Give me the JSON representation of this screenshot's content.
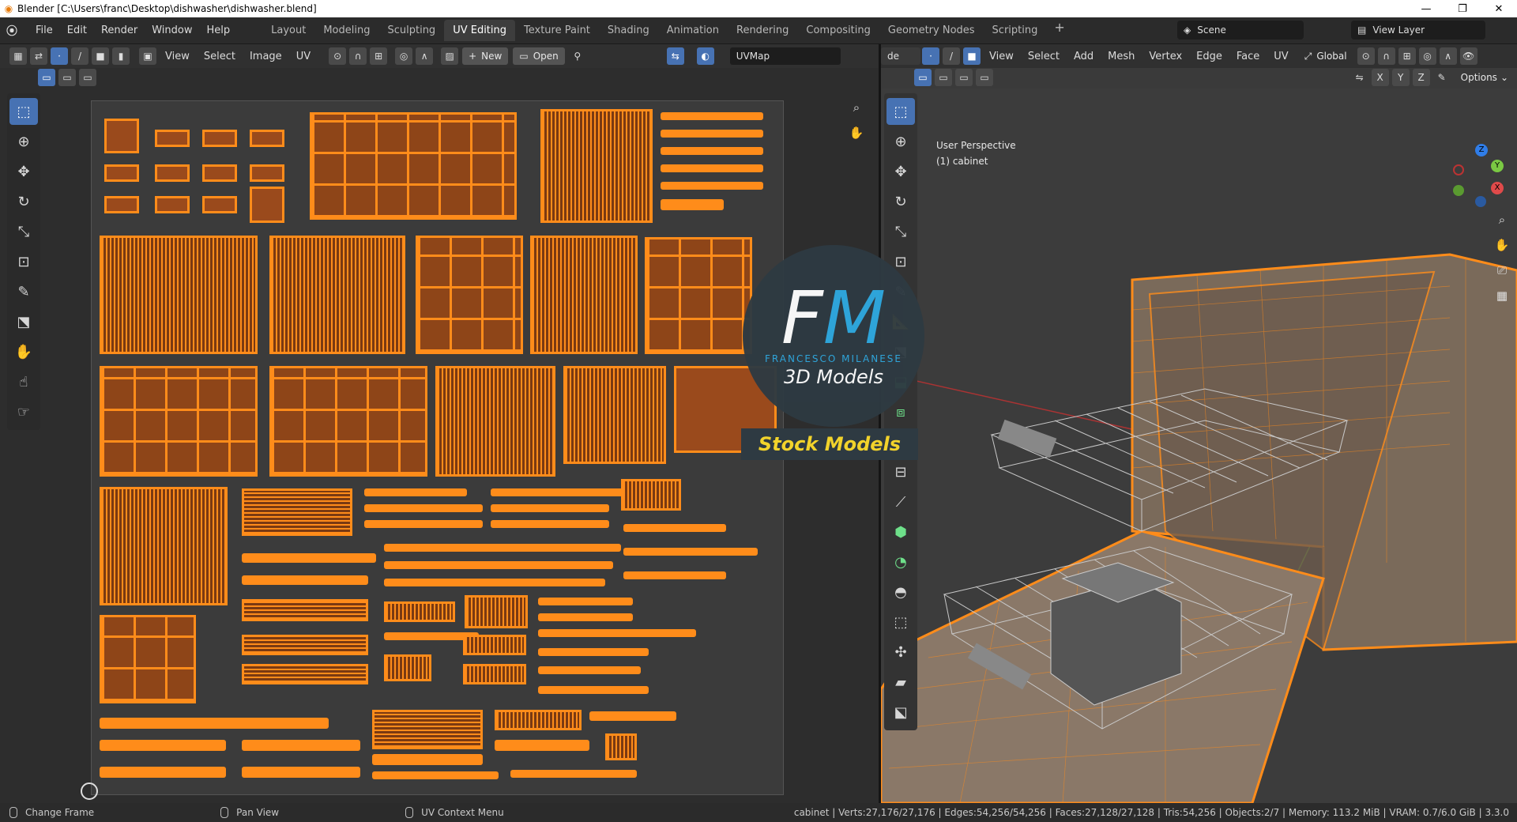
{
  "window": {
    "title": "Blender [C:\\Users\\franc\\Desktop\\dishwasher\\dishwasher.blend]",
    "minimize": "—",
    "maximize": "❐",
    "close": "✕"
  },
  "menus": [
    "File",
    "Edit",
    "Render",
    "Window",
    "Help"
  ],
  "workspaces": [
    "Layout",
    "Modeling",
    "Sculpting",
    "UV Editing",
    "Texture Paint",
    "Shading",
    "Animation",
    "Rendering",
    "Compositing",
    "Geometry Nodes",
    "Scripting"
  ],
  "active_workspace": "UV Editing",
  "scene": "Scene",
  "view_layer": "View Layer",
  "uv_editor": {
    "menus": [
      "View",
      "Select",
      "Image",
      "UV"
    ],
    "new_label": "New",
    "open_label": "Open",
    "uvmap": "UVMap"
  },
  "viewport": {
    "mode": "de",
    "menus": [
      "View",
      "Select",
      "Add",
      "Mesh",
      "Vertex",
      "Edge",
      "Face",
      "UV"
    ],
    "transform": "Global",
    "options": "Options",
    "axes": [
      "X",
      "Y",
      "Z"
    ],
    "info_line1": "User Perspective",
    "info_line2": "(1) cabinet"
  },
  "watermark": {
    "fm_f": "F",
    "fm_m": "M",
    "name": "FRANCESCO MILANESE",
    "sub": "3D Models",
    "stock": "Stock Models"
  },
  "statusbar": {
    "left": "Change Frame",
    "middle": "Pan View",
    "right": "UV Context Menu",
    "stats": "cabinet | Verts:27,176/27,176 | Edges:54,256/54,256 | Faces:27,128/27,128 | Tris:54,256 | Objects:2/7 | Memory: 113.2 MiB | VRAM: 0.7/6.0 GiB | 3.3.0"
  },
  "colors": {
    "accent": "#4772b3",
    "uv_orange": "#ff8c1a",
    "wire_orange": "#ff8c1a"
  }
}
